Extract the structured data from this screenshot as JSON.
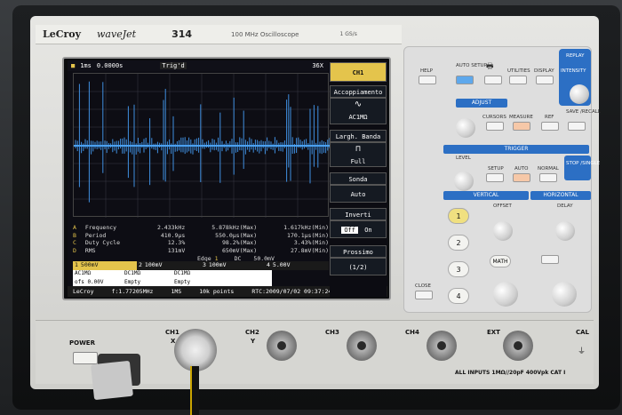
{
  "device": {
    "brand": "LeCroy",
    "series": "waveJet",
    "model": "314",
    "description": "100 MHz Oscilloscope",
    "rate": "1 GS/s"
  },
  "screen": {
    "timebase": "1ms",
    "delay": "0.0000s",
    "trigger": "Trig'd",
    "trigger_level": "36X",
    "menu": {
      "channel": "CH1",
      "coupling_label": "Accoppiamento",
      "coupling_value": "AC1MΩ",
      "bw_label": "Largh. Banda",
      "bw_value": "Full",
      "probe_label": "Sonda",
      "probe_value": "Auto",
      "invert_label": "Inverti",
      "invert_off": "Off",
      "invert_on": "On",
      "next_label": "Prossimo",
      "next_value": "(1/2)"
    },
    "measurements": [
      {
        "id": "A",
        "name": "Frequency",
        "value": "2.433kHz",
        "max": "5.878kHz(Max)",
        "min": "1.617kHz(Min)"
      },
      {
        "id": "B",
        "name": "Period",
        "value": "410.9µs",
        "max": "550.0µs(Max)",
        "min": "170.1µs(Min)"
      },
      {
        "id": "C",
        "name": "Duty Cycle",
        "value": "12.3%",
        "max": "98.2%(Max)",
        "min": "3.43%(Min)"
      },
      {
        "id": "D",
        "name": "RMS",
        "value": "131mV",
        "max": "650mV(Max)",
        "min": "27.8mV(Min)"
      }
    ],
    "trig_edge": "Edge",
    "trig_ch": "1",
    "trig_dc": "DC",
    "trig_lvl": "50.0mV",
    "channels": [
      {
        "id": "1",
        "scale": "500mV"
      },
      {
        "id": "2",
        "scale": "100mV"
      },
      {
        "id": "3",
        "scale": "100mV"
      },
      {
        "id": "4",
        "scale": "5.00V"
      }
    ],
    "channel_table": [
      [
        "AC1MΩ",
        "DC1MΩ",
        "DC1MΩ",
        ""
      ],
      [
        "ofs  0.00V",
        "Empty",
        "Empty",
        ""
      ]
    ],
    "footer": {
      "logo": "LeCroy",
      "freq": "f:1.77205MHz",
      "rate": "1MS",
      "points": "10k points",
      "rtc": "RTC:2009/07/02 09:37:24"
    }
  },
  "panel": {
    "help": "HELP",
    "auto_setup": "AUTO SETUP",
    "utilities": "UTILITIES",
    "display": "DISPLAY",
    "intensity": "INTENSITY",
    "replay": "REPLAY",
    "adjust": "ADJUST",
    "cursors": "CURSORS",
    "measure": "MEASURE",
    "ref": "REF",
    "save_recall": "SAVE /RECALL",
    "trigger": "TRIGGER",
    "level": "LEVEL",
    "setup": "SETUP",
    "auto": "AUTO",
    "normal": "NORMAL",
    "stop_single": "STOP /SINGLE",
    "vertical": "VERTICAL",
    "offset": "OFFSET",
    "horizontal": "HORIZONTAL",
    "delay": "DELAY",
    "math": "MATH",
    "close": "CLOSE",
    "ch_buttons": [
      "1",
      "2",
      "3",
      "4"
    ]
  },
  "inputs": {
    "power": "POWER",
    "ch1": "CH1",
    "ch1_sub": "X",
    "ch2": "CH2",
    "ch2_sub": "Y",
    "ch3": "CH3",
    "ch4": "CH4",
    "ext": "EXT",
    "cal": "CAL",
    "warning": "ALL INPUTS 1MΩ//20pF 400Vpk CAT I"
  }
}
